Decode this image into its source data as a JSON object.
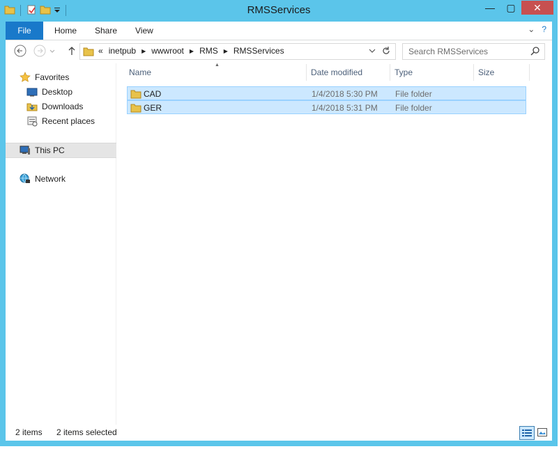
{
  "window": {
    "title": "RMSServices"
  },
  "title_buttons": {
    "minimize": "—",
    "maximize": "▢",
    "close": "✕"
  },
  "ribbon": {
    "tabs": [
      {
        "label": "File"
      },
      {
        "label": "Home"
      },
      {
        "label": "Share"
      },
      {
        "label": "View"
      }
    ],
    "collapse_glyph": "⌄",
    "help_glyph": "?"
  },
  "address_bar": {
    "overflow": "«",
    "crumbs": [
      "inetpub",
      "wwwroot",
      "RMS",
      "RMSServices"
    ]
  },
  "search": {
    "placeholder": "Search RMSServices"
  },
  "nav_pane": {
    "favorites": {
      "label": "Favorites",
      "items": [
        {
          "label": "Desktop"
        },
        {
          "label": "Downloads"
        },
        {
          "label": "Recent places"
        }
      ]
    },
    "this_pc": {
      "label": "This PC"
    },
    "network": {
      "label": "Network"
    }
  },
  "columns": [
    {
      "label": "Name"
    },
    {
      "label": "Date modified"
    },
    {
      "label": "Type"
    },
    {
      "label": "Size"
    }
  ],
  "files": [
    {
      "name": "CAD",
      "date": "1/4/2018 5:30 PM",
      "type": "File folder",
      "size": ""
    },
    {
      "name": "GER",
      "date": "1/4/2018 5:31 PM",
      "type": "File folder",
      "size": ""
    }
  ],
  "status": {
    "count": "2 items",
    "selected": "2 items selected"
  },
  "colors": {
    "frame": "#5bc5ea",
    "file_tab": "#1979ca",
    "selection": "#cce8ff",
    "selection_border": "#99d1ff",
    "close": "#c75050"
  }
}
